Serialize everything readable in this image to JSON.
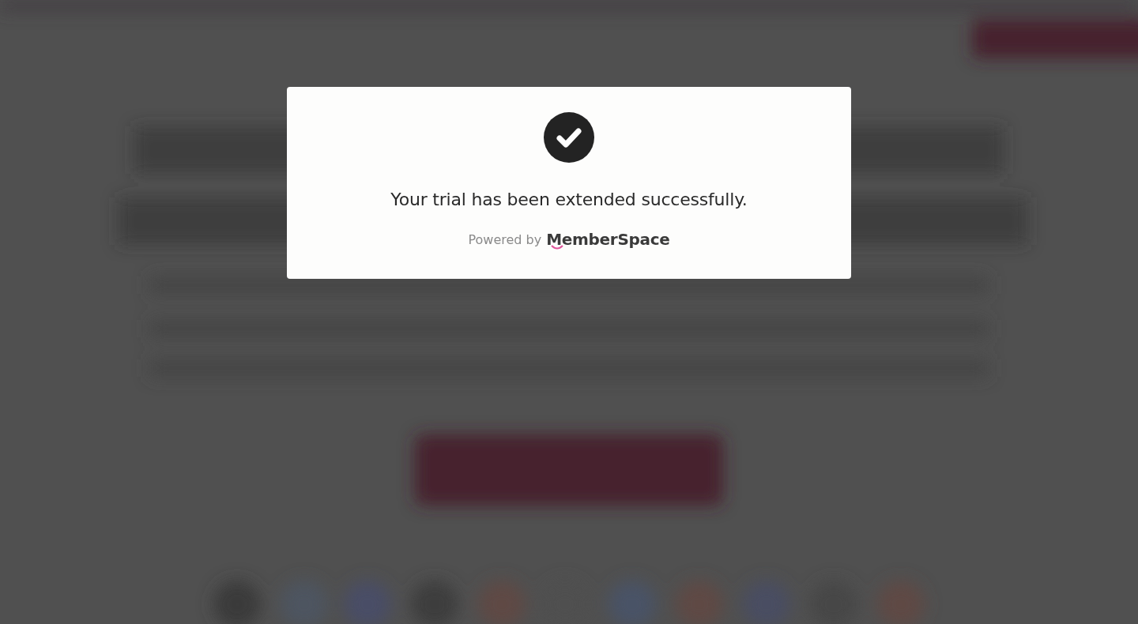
{
  "modal": {
    "kind": "success",
    "message": "Your trial has been extended successfully.",
    "powered_by": "Powered by",
    "brand": "MemberSpace"
  }
}
